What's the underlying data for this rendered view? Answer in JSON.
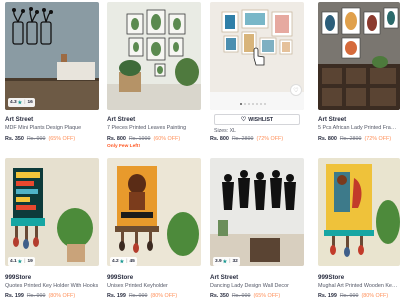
{
  "products": [
    {
      "brand": "Art Street",
      "name": "MDF Mini Plants Design Plaque",
      "price": "Rs. 350",
      "mrp": "Rs. 999",
      "off": "(65% OFF)",
      "rating": "4.3",
      "count": "16"
    },
    {
      "brand": "Art Street",
      "name": "7 Pieces Printed Leaves Painting",
      "price": "Rs. 800",
      "mrp": "Rs. 1999",
      "off": "(60% OFF)",
      "note": "Only Few Left!"
    },
    {
      "brand": "",
      "sizes": "Sizes: XL",
      "price": "Rs. 800",
      "mrp": "Rs. 2899",
      "off": "(72% OFF)",
      "wishlist": "WISHLIST"
    },
    {
      "brand": "Art Street",
      "name": "5 Pcs African Lady Printed Frames",
      "price": "Rs. 800",
      "mrp": "Rs. 2899",
      "off": "(72% OFF)"
    },
    {
      "brand": "999Store",
      "name": "Quotes Printed Key Holder With Hooks",
      "price": "Rs. 199",
      "mrp": "Rs. 999",
      "off": "(80% OFF)",
      "rating": "4.1",
      "count": "19"
    },
    {
      "brand": "999Store",
      "name": "Unisex Printed Keyholder",
      "price": "Rs. 199",
      "mrp": "Rs. 999",
      "off": "(80% OFF)",
      "rating": "4.2",
      "count": "45"
    },
    {
      "brand": "Art Street",
      "name": "Dancing Lady Design Wall Decor",
      "price": "Rs. 350",
      "mrp": "Rs. 999",
      "off": "(65% OFF)",
      "rating": "3.9",
      "count": "32"
    },
    {
      "brand": "999Store",
      "name": "Mughal Art Printed Wooden Keyholder",
      "price": "Rs. 199",
      "mrp": "Rs. 999",
      "off": "(80% OFF)"
    }
  ],
  "colors": {
    "teal": "#14958f",
    "orange": "#ff905a",
    "pink": "#ff3f6c"
  }
}
